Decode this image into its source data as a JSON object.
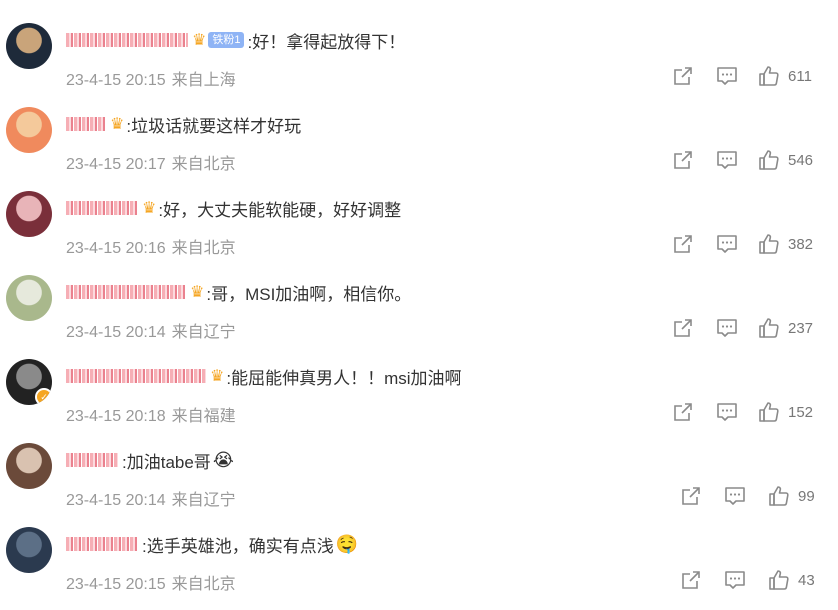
{
  "comments": [
    {
      "name_width": 122,
      "has_fans_badge": true,
      "fans_label": "铁粉1",
      "text": ":好！拿得起放得下！",
      "emoji": "",
      "time": "23-4-15 20:15",
      "location": "来自上海",
      "likes": "611",
      "avatar_colors": [
        "#1e2a3a",
        "#c9a47a"
      ],
      "avatar_verified": false
    },
    {
      "name_width": 40,
      "has_fans_badge": false,
      "fans_label": "",
      "text": ":垃圾话就要这样才好玩",
      "emoji": "",
      "time": "23-4-15 20:17",
      "location": "来自北京",
      "likes": "546",
      "avatar_colors": [
        "#f08a5d",
        "#f4c99b"
      ],
      "avatar_verified": false
    },
    {
      "name_width": 72,
      "has_fans_badge": false,
      "fans_label": "",
      "text": ":好，大丈夫能软能硬，好好调整",
      "emoji": "",
      "time": "23-4-15 20:16",
      "location": "来自北京",
      "likes": "382",
      "avatar_colors": [
        "#7a2f3a",
        "#e8b4b8"
      ],
      "avatar_verified": false
    },
    {
      "name_width": 120,
      "has_fans_badge": false,
      "fans_label": "",
      "text": ":哥，MSI加油啊，相信你。",
      "emoji": "",
      "time": "23-4-15 20:14",
      "location": "来自辽宁",
      "likes": "237",
      "avatar_colors": [
        "#a9b88c",
        "#e6e9dc"
      ],
      "avatar_verified": false
    },
    {
      "name_width": 140,
      "has_fans_badge": false,
      "fans_label": "",
      "text": ":能屈能伸真男人！！msi加油啊",
      "emoji": "",
      "time": "23-4-15 20:18",
      "location": "来自福建",
      "likes": "152",
      "avatar_colors": [
        "#222222",
        "#8a8a8a"
      ],
      "avatar_verified": true
    },
    {
      "name_width": 52,
      "has_fans_badge": false,
      "fans_label": "",
      "text": ":加油tabe哥",
      "emoji": "😭",
      "time": "23-4-15 20:14",
      "location": "来自辽宁",
      "likes": "99",
      "avatar_colors": [
        "#6b4a3a",
        "#d9c2b0"
      ],
      "avatar_verified": false
    },
    {
      "name_width": 72,
      "has_fans_badge": false,
      "fans_label": "",
      "text": ":选手英雄池，确实有点浅",
      "emoji": "🤤",
      "time": "23-4-15 20:15",
      "location": "来自北京",
      "likes": "43",
      "avatar_colors": [
        "#2b3a4f",
        "#5c6f86"
      ],
      "avatar_verified": false
    }
  ],
  "icons": {
    "forward": "forward-icon",
    "comment": "comment-icon",
    "like": "thumb-up-icon"
  },
  "colors": {
    "text": "#333333",
    "meta": "#999999",
    "icon": "#8a8a8a",
    "fans_badge": "#8fb4f5",
    "crown": "#f5a623"
  }
}
